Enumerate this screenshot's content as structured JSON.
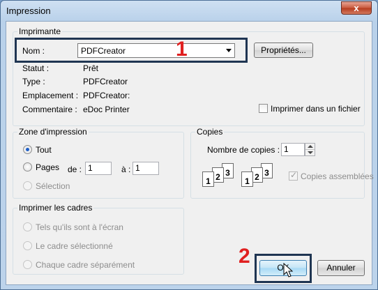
{
  "window": {
    "title": "Impression",
    "close_label": "x"
  },
  "printer": {
    "group_label": "Imprimante",
    "name_label": "Nom :",
    "name_value": "PDFCreator",
    "properties_button": "Propriétés...",
    "status_label": "Statut :",
    "status_value": "Prêt",
    "type_label": "Type :",
    "type_value": "PDFCreator",
    "location_label": "Emplacement :",
    "location_value": "PDFCreator:",
    "comment_label": "Commentaire :",
    "comment_value": "eDoc Printer",
    "print_to_file_label": "Imprimer dans un fichier"
  },
  "print_range": {
    "group_label": "Zone d'impression",
    "all_label": "Tout",
    "pages_label": "Pages",
    "from_label": "de :",
    "from_value": "1",
    "to_label": "à :",
    "to_value": "1",
    "selection_label": "Sélection"
  },
  "copies": {
    "group_label": "Copies",
    "count_label": "Nombre de copies :",
    "count_value": "1",
    "collate_label": "Copies assemblées",
    "stack_a": [
      "1",
      "2",
      "3"
    ],
    "stack_b": [
      "1",
      "2",
      "3"
    ]
  },
  "frames": {
    "group_label": "Imprimer les cadres",
    "as_on_screen": "Tels qu'ils sont à l'écran",
    "selected_frame": "Le cadre sélectionné",
    "each_frame": "Chaque cadre séparément"
  },
  "buttons": {
    "ok": "OK",
    "cancel": "Annuler"
  },
  "annotations": {
    "num1": "1",
    "num2": "2",
    "color": "#e02020"
  }
}
